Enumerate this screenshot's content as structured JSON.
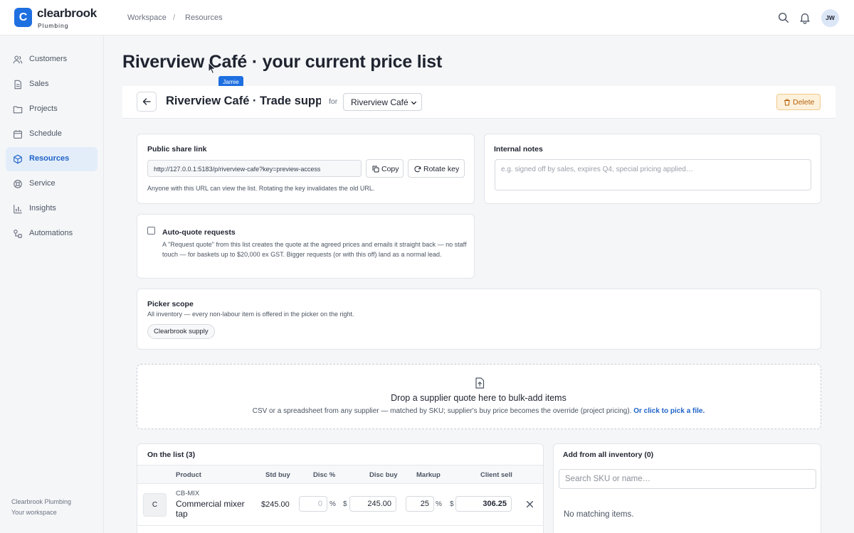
{
  "brand": {
    "logo_letter": "C",
    "name": "clearbrook",
    "sub": "Plumbing"
  },
  "breadcrumb": [
    "Workspace",
    "Resources"
  ],
  "breadcrumb_sep": "/",
  "user_initials": "JW",
  "sidebar": {
    "items": [
      {
        "label": "Customers",
        "icon": "users-icon"
      },
      {
        "label": "Sales",
        "icon": "document-icon"
      },
      {
        "label": "Projects",
        "icon": "folder-icon"
      },
      {
        "label": "Schedule",
        "icon": "calendar-icon"
      },
      {
        "label": "Resources",
        "icon": "cube-icon",
        "active": true
      },
      {
        "label": "Service",
        "icon": "lifebuoy-icon"
      },
      {
        "label": "Insights",
        "icon": "bar-chart-icon"
      },
      {
        "label": "Automations",
        "icon": "workflow-icon"
      }
    ],
    "footer_name": "Clearbrook Plumbing",
    "footer_sub": "Your workspace"
  },
  "page_title": "Riverview Café · your current price list",
  "cursor_tooltip": "Jamie",
  "header": {
    "title": "Riverview Café · Trade supplies",
    "for_label": "for",
    "client_select": "Riverview Café",
    "delete_label": "Delete"
  },
  "share": {
    "title": "Public share link",
    "url": "http://127.0.0.1:5183/p/riverview-cafe?key=preview-access",
    "copy_label": "Copy",
    "rotate_label": "Rotate key",
    "hint": "Anyone with this URL can view the list. Rotating the key invalidates the old URL."
  },
  "notes": {
    "title": "Internal notes",
    "placeholder": "e.g. signed off by sales, expires Q4, special pricing applied…"
  },
  "auto_quote": {
    "title": "Auto-quote requests",
    "checked": false,
    "description": "A \"Request quote\" from this list creates the quote at the agreed prices and emails it straight back — no staff touch — for baskets up to $20,000 ex GST. Bigger requests (or with this off) land as a normal lead."
  },
  "picker": {
    "title": "Picker scope",
    "description": "All inventory — every non-labour item is offered in the picker on the right.",
    "chip": "Clearbrook supply"
  },
  "dropzone": {
    "title": "Drop a supplier quote here to bulk-add items",
    "subtitle": "CSV or a spreadsheet from any supplier — matched by SKU; supplier's buy price becomes the override (project pricing).",
    "link": "Or click to pick a file."
  },
  "list": {
    "title": "On the list (3)",
    "columns": [
      "Product",
      "Std buy",
      "Disc %",
      "Disc buy",
      "Markup",
      "Client sell"
    ],
    "rows": [
      {
        "thumb": "C",
        "sku": "CB-MIX",
        "name": "Commercial mixer tap",
        "std_buy": "$245.00",
        "disc_pct": "0",
        "pct_unit": "%",
        "currency": "$",
        "disc_buy": "245.00",
        "markup": "25",
        "client_sell": "306.25"
      }
    ]
  },
  "inventory": {
    "title": "Add from all inventory (0)",
    "search_placeholder": "Search SKU or name…",
    "empty": "No matching items."
  }
}
